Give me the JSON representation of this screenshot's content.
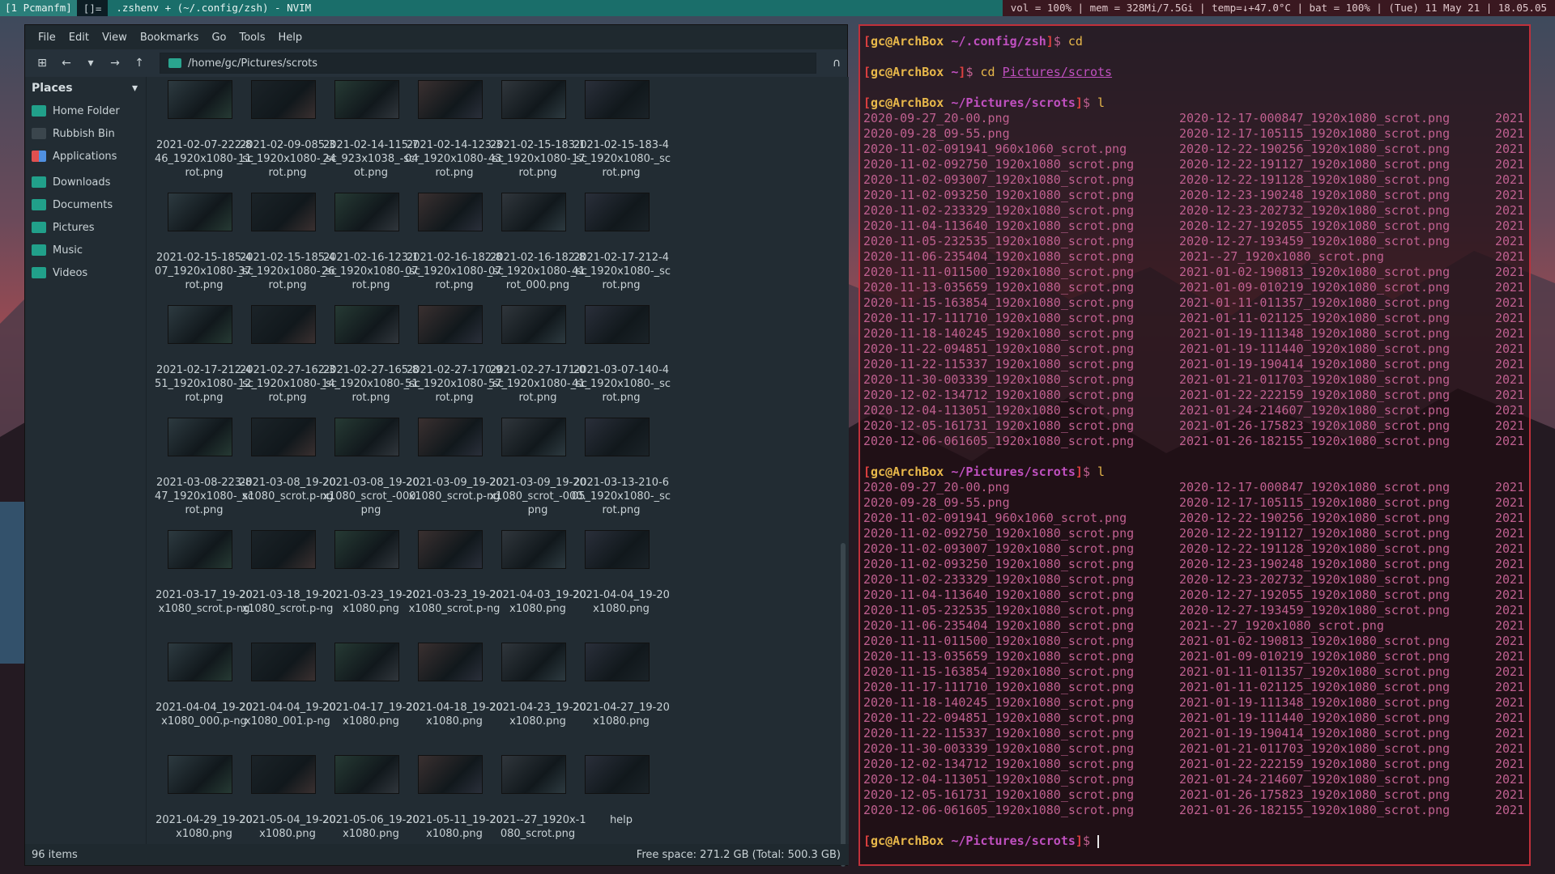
{
  "topbar": {
    "workspace": "[1 Pcmanfm]",
    "layout": "[]=",
    "window_title": ".zshenv + (~/.config/zsh) - NVIM",
    "status": "vol = 100% | mem = 328Mi/7.5Gi | temp=↓+47.0°C | bat = 100% | (Tue) 11 May 21 | 18.05.05"
  },
  "pcmanfm": {
    "menu": [
      "File",
      "Edit",
      "View",
      "Bookmarks",
      "Go",
      "Tools",
      "Help"
    ],
    "path": "/home/gc/Pictures/scrots",
    "places_header": "Places",
    "places": [
      "Home Folder",
      "Rubbish Bin",
      "Applications",
      "Downloads",
      "Documents",
      "Pictures",
      "Music",
      "Videos"
    ],
    "files": [
      "2021-02-07-222-846_1920x1080-_scrot.png",
      "2021-02-09-085-311_1920x1080-_scrot.png",
      "2021-02-14-115-724_923x1038_-scrot.png",
      "2021-02-14-123-304_1920x1080-_scrot.png",
      "2021-02-15-183-143_1920x1080-_scrot.png",
      "2021-02-15-183-417_1920x1080-_scrot.png",
      "2021-02-15-185-407_1920x1080-_scrot.png",
      "2021-02-15-185-437_1920x1080-_scrot.png",
      "2021-02-16-123-126_1920x1080-_scrot.png",
      "2021-02-16-182-807_1920x1080-_scrot.png",
      "2021-02-16-182-807_1920x1080-_scrot_000.png",
      "2021-02-17-212-441_1920x1080-_scrot.png",
      "2021-02-17-212-451_1920x1080-_scrot.png",
      "2021-02-27-162-312_1920x1080-_scrot.png",
      "2021-02-27-165-814_1920x1080-_scrot.png",
      "2021-02-27-170-951_1920x1080-_scrot.png",
      "2021-02-27-171-057_1920x1080-_scrot.png",
      "2021-03-07-140-441_1920x1080-_scrot.png",
      "2021-03-08-223-847_1920x1080-_scrot.png",
      "2021-03-08_19-20x1080_scrot.p-ng",
      "2021-03-08_19-20x1080_scrot_-000.png",
      "2021-03-09_19-20x1080_scrot.p-ng",
      "2021-03-09_19-20x1080_scrot_-000.png",
      "2021-03-13-210-605_1920x1080-_scrot.png",
      "2021-03-17_19-20x1080_scrot.p-ng",
      "2021-03-18_19-20x1080_scrot.p-ng",
      "2021-03-23_19-20x1080.png",
      "2021-03-23_19-20x1080_scrot.p-ng",
      "2021-04-03_19-20x1080.png",
      "2021-04-04_19-20x1080.png",
      "2021-04-04_19-20x1080_000.p-ng",
      "2021-04-04_19-20x1080_001.p-ng",
      "2021-04-17_19-20x1080.png",
      "2021-04-18_19-20x1080.png",
      "2021-04-23_19-20x1080.png",
      "2021-04-27_19-20x1080.png",
      "2021-04-29_19-20x1080.png",
      "2021-05-04_19-20x1080.png",
      "2021-05-06_19-20x1080.png",
      "2021-05-11_19-20x1080.png",
      "2021--27_1920x-1080_scrot.png",
      "help"
    ],
    "item_count": "96 items",
    "free_space": "Free space: 271.2 GB (Total: 500.3 GB)"
  },
  "terminal": {
    "prompt1_path": "~/.config/zsh",
    "prompt1_cmd": "cd",
    "prompt2_path": "~",
    "prompt2_cmd_a": "cd ",
    "prompt2_cmd_b": "Pictures/scrots",
    "prompt3_path": "~/Pictures/scrots",
    "prompt3_cmd": "l",
    "prompt4_path": "~/Pictures/scrots",
    "prompt4_cmd": "l",
    "prompt5_path": "~/Pictures/scrots",
    "user_host": "gc@ArchBox",
    "col1": [
      "2020-09-27_20-00.png",
      "2020-09-28_09-55.png",
      "2020-11-02-091941_960x1060_scrot.png",
      "2020-11-02-092750_1920x1080_scrot.png",
      "2020-11-02-093007_1920x1080_scrot.png",
      "2020-11-02-093250_1920x1080_scrot.png",
      "2020-11-02-233329_1920x1080_scrot.png",
      "2020-11-04-113640_1920x1080_scrot.png",
      "2020-11-05-232535_1920x1080_scrot.png",
      "2020-11-06-235404_1920x1080_scrot.png",
      "2020-11-11-011500_1920x1080_scrot.png",
      "2020-11-13-035659_1920x1080_scrot.png",
      "2020-11-15-163854_1920x1080_scrot.png",
      "2020-11-17-111710_1920x1080_scrot.png",
      "2020-11-18-140245_1920x1080_scrot.png",
      "2020-11-22-094851_1920x1080_scrot.png",
      "2020-11-22-115337_1920x1080_scrot.png",
      "2020-11-30-003339_1920x1080_scrot.png",
      "2020-12-02-134712_1920x1080_scrot.png",
      "2020-12-04-113051_1920x1080_scrot.png",
      "2020-12-05-161731_1920x1080_scrot.png",
      "2020-12-06-061605_1920x1080_scrot.png"
    ],
    "col2": [
      "2020-12-17-000847_1920x1080_scrot.png",
      "2020-12-17-105115_1920x1080_scrot.png",
      "2020-12-22-190256_1920x1080_scrot.png",
      "2020-12-22-191127_1920x1080_scrot.png",
      "2020-12-22-191128_1920x1080_scrot.png",
      "2020-12-23-190248_1920x1080_scrot.png",
      "2020-12-23-202732_1920x1080_scrot.png",
      "2020-12-27-192055_1920x1080_scrot.png",
      "2020-12-27-193459_1920x1080_scrot.png",
      "2021--27_1920x1080_scrot.png",
      "2021-01-02-190813_1920x1080_scrot.png",
      "2021-01-09-010219_1920x1080_scrot.png",
      "2021-01-11-011357_1920x1080_scrot.png",
      "2021-01-11-021125_1920x1080_scrot.png",
      "2021-01-19-111348_1920x1080_scrot.png",
      "2021-01-19-111440_1920x1080_scrot.png",
      "2021-01-19-190414_1920x1080_scrot.png",
      "2021-01-21-011703_1920x1080_scrot.png",
      "2021-01-22-222159_1920x1080_scrot.png",
      "2021-01-24-214607_1920x1080_scrot.png",
      "2021-01-26-175823_1920x1080_scrot.png",
      "2021-01-26-182155_1920x1080_scrot.png"
    ],
    "col3": "2021"
  }
}
